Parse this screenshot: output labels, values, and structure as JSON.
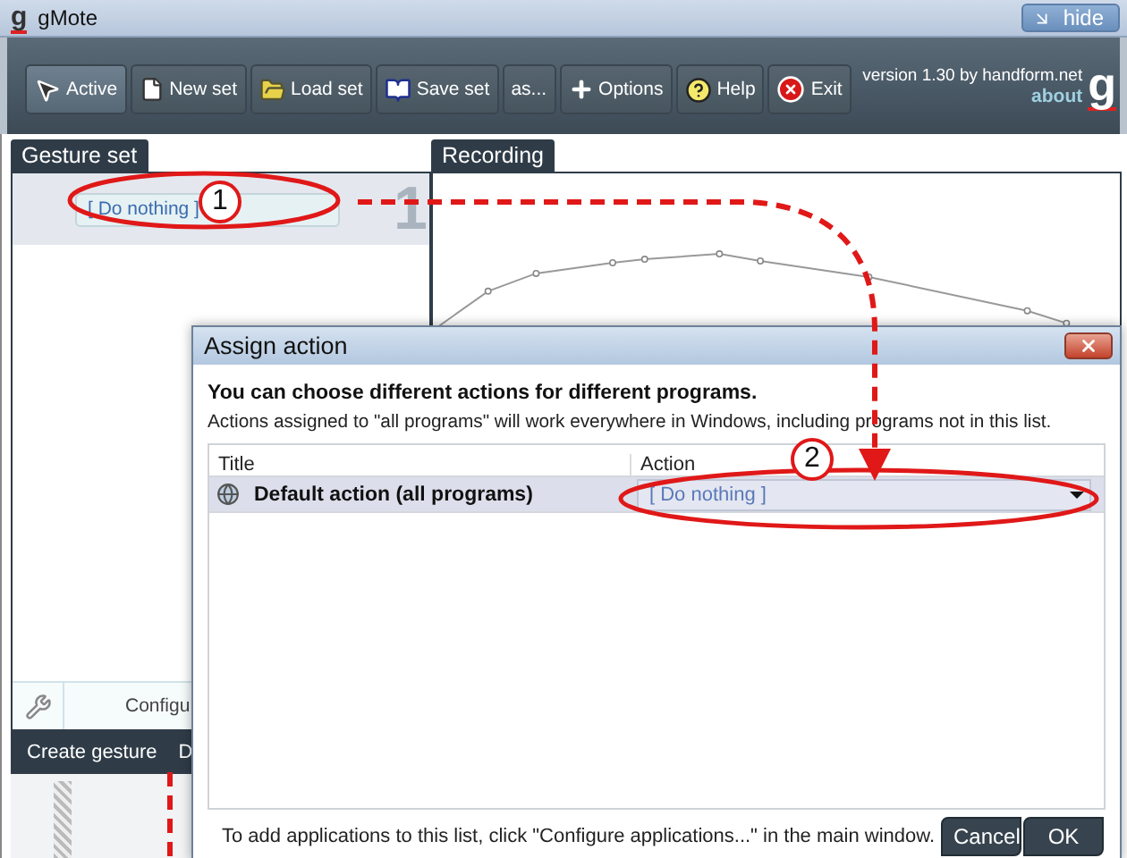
{
  "window": {
    "logo": "g",
    "title": "gMote",
    "hide_button": "hide"
  },
  "toolbar": {
    "buttons": [
      {
        "label": "Active",
        "kind": "cursor",
        "selected": true
      },
      {
        "label": "New set",
        "kind": "page",
        "selected": false
      },
      {
        "label": "Load set",
        "kind": "folder",
        "selected": false
      },
      {
        "label": "Save set",
        "kind": "book",
        "selected": false
      },
      {
        "label": "as...",
        "kind": "plain",
        "selected": false
      },
      {
        "label": "Options",
        "kind": "plus",
        "selected": false
      },
      {
        "label": "Help",
        "kind": "help",
        "selected": false
      },
      {
        "label": "Exit",
        "kind": "exit",
        "selected": false
      }
    ],
    "version": "version 1.30 by handform.net",
    "about": "about",
    "logo": "g"
  },
  "gesture_set": {
    "tab": "Gesture set",
    "gestures": [
      {
        "action": "[ Do nothing ]",
        "number": "1",
        "selected": true
      }
    ],
    "configure": "Configu",
    "create": "Create gesture",
    "next": "D"
  },
  "recording": {
    "tab": "Recording"
  },
  "dialog": {
    "title": "Assign action",
    "heading": "You can choose different actions for different programs.",
    "description": "Actions assigned to \"all programs\" will work everywhere in Windows, including programs not in this list.",
    "columns": [
      "Title",
      "Action"
    ],
    "rows": [
      {
        "title": "Default action (all programs)",
        "action": "[ Do nothing ]",
        "selected": true
      }
    ],
    "footer": "To add applications to this list, click \"Configure applications...\" in the main window.",
    "buttons": [
      "Cancel",
      "OK"
    ]
  },
  "callouts": [
    {
      "number": "1"
    },
    {
      "number": "2"
    }
  ]
}
